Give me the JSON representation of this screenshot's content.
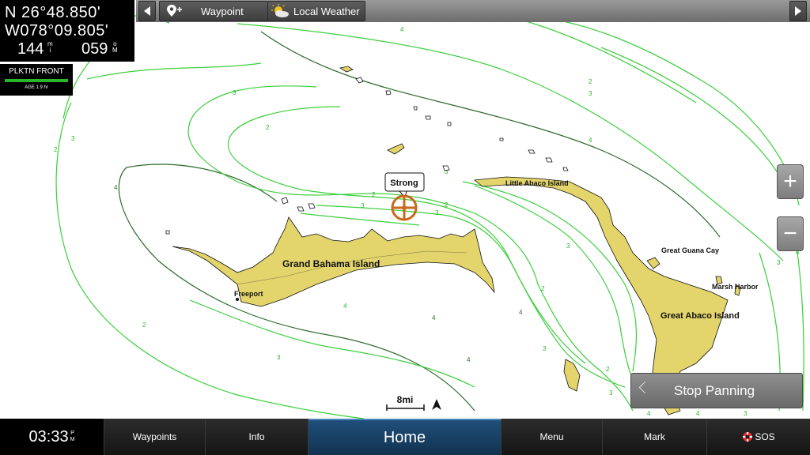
{
  "position": {
    "lat": "N  26°48.850'",
    "lon": "W078°09.805'",
    "distance": "144",
    "distance_unit_top": "m",
    "distance_unit_bot": "i",
    "bearing": "059",
    "bearing_unit_top": "o",
    "bearing_unit_bot": "M"
  },
  "weather_overlay": {
    "title": "PLKTN FRONT",
    "age": "AGE 1.9 hr"
  },
  "toolbar": {
    "waypoint_label": "Waypoint",
    "local_weather_label": "Local Weather"
  },
  "map": {
    "labels": {
      "grand_bahama": "Grand Bahama Island",
      "freeport": "Freeport",
      "little_abaco": "Little Abaco Island",
      "great_guana": "Great Guana Cay",
      "marsh_harbor": "Marsh Harbor",
      "great_abaco": "Great Abaco Island"
    },
    "marker_callout": "Strong",
    "scale": "8mi",
    "contour_values": [
      "2",
      "3",
      "4"
    ],
    "colors": {
      "land": "#e3d56c",
      "contour_light": "#3ccf3c",
      "contour_dark": "#2e6b2e",
      "marker": "#c8691c"
    }
  },
  "controls": {
    "zoom_in": "+",
    "zoom_out": "−",
    "stop_panning": "Stop Panning"
  },
  "bottom_bar": {
    "time": "03:33",
    "time_suffix_top": "P",
    "time_suffix_bot": "M",
    "waypoints": "Waypoints",
    "info": "Info",
    "home": "Home",
    "menu": "Menu",
    "mark": "Mark",
    "sos": "SOS"
  }
}
